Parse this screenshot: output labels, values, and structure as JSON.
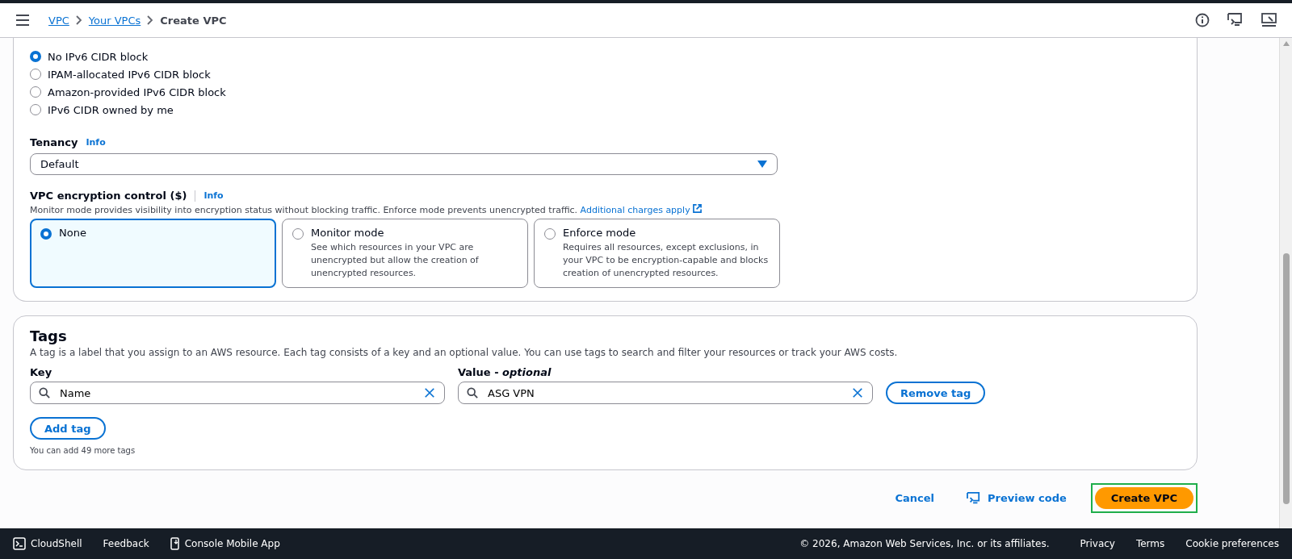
{
  "breadcrumbs": [
    {
      "label": "VPC",
      "link": true
    },
    {
      "label": "Your VPCs",
      "link": true
    },
    {
      "label": "Create VPC",
      "link": false
    }
  ],
  "ipv6_options": [
    {
      "label": "No IPv6 CIDR block",
      "selected": true
    },
    {
      "label": "IPAM-allocated IPv6 CIDR block",
      "selected": false
    },
    {
      "label": "Amazon-provided IPv6 CIDR block",
      "selected": false
    },
    {
      "label": "IPv6 CIDR owned by me",
      "selected": false
    }
  ],
  "tenancy": {
    "label": "Tenancy",
    "info": "Info",
    "value": "Default"
  },
  "encryption": {
    "label": "VPC encryption control ($)",
    "info": "Info",
    "description": "Monitor mode provides visibility into encryption status without blocking traffic. Enforce mode prevents unencrypted traffic.",
    "link": "Additional charges apply",
    "options": [
      {
        "title": "None",
        "selected": true
      },
      {
        "title": "Monitor mode",
        "description": "See which resources in your VPC are unencrypted but allow the creation of unencrypted resources.",
        "selected": false
      },
      {
        "title": "Enforce mode",
        "description": "Requires all resources, except exclusions, in your VPC to be encryption-capable and blocks creation of unencrypted resources.",
        "selected": false
      }
    ]
  },
  "tags": {
    "title": "Tags",
    "description": "A tag is a label that you assign to an AWS resource. Each tag consists of a key and an optional value. You can use tags to search and filter your resources or track your AWS costs.",
    "key_label": "Key",
    "value_label": "Value - *optional*",
    "key": "Name",
    "value": "ASG VPN",
    "remove": "Remove tag",
    "add": "Add tag",
    "note": "You can add 49 more tags"
  },
  "actions": {
    "cancel": "Cancel",
    "preview": "Preview code",
    "create": "Create VPC"
  },
  "footer": {
    "left": [
      "CloudShell",
      "Feedback",
      "Console Mobile App"
    ],
    "copyright": "© 2026, Amazon Web Services, Inc. or its affiliates.",
    "links": [
      "Privacy",
      "Terms",
      "Cookie preferences"
    ]
  }
}
